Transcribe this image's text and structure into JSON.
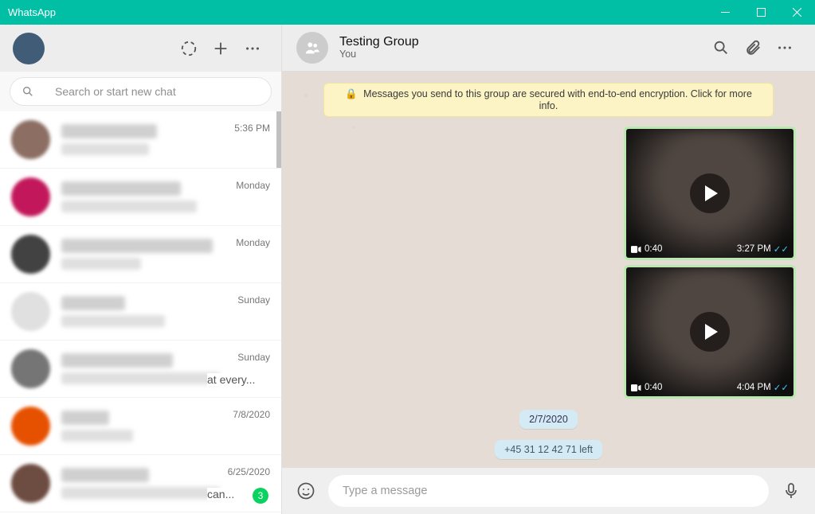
{
  "app": {
    "title": "WhatsApp"
  },
  "search": {
    "placeholder": "Search or start new chat"
  },
  "chatlist": [
    {
      "time": "5:36 PM"
    },
    {
      "time": "Monday"
    },
    {
      "time": "Monday"
    },
    {
      "time": "Sunday"
    },
    {
      "time": "Sunday",
      "preview_suffix": "at every..."
    },
    {
      "time": "7/8/2020"
    },
    {
      "time": "6/25/2020",
      "preview_suffix": "can...",
      "unread": "3"
    }
  ],
  "chat": {
    "title": "Testing Group",
    "subtitle": "You",
    "encryption_notice": "Messages you send to this group are secured with end-to-end encryption. Click for more info.",
    "videos": [
      {
        "duration": "0:40",
        "time": "3:27 PM"
      },
      {
        "duration": "0:40",
        "time": "4:04 PM"
      }
    ],
    "date_pill": "2/7/2020",
    "system_pill": "+45 31 12 42 71 left"
  },
  "composer": {
    "placeholder": "Type a message"
  }
}
